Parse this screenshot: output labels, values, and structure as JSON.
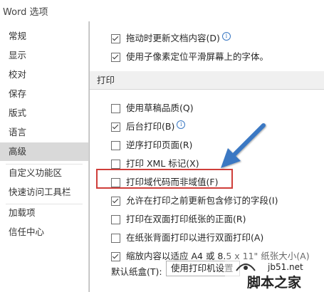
{
  "window": {
    "title": "Word 选项"
  },
  "sidebar": {
    "items": [
      {
        "label": "常规"
      },
      {
        "label": "显示"
      },
      {
        "label": "校对"
      },
      {
        "label": "保存"
      },
      {
        "label": "版式"
      },
      {
        "label": "语言"
      },
      {
        "label": "高级",
        "active": true
      },
      {
        "label": "自定义功能区"
      },
      {
        "label": "快速访问工具栏"
      },
      {
        "label": "加载项"
      },
      {
        "label": "信任中心"
      }
    ]
  },
  "options_top": [
    {
      "label": "拖动时更新文档内容(D)",
      "checked": true,
      "info_icon": true
    },
    {
      "label": "使用子像素定位平滑屏幕上的字体。",
      "checked": true
    }
  ],
  "print_section": {
    "header": "打印",
    "options": [
      {
        "label": "使用草稿品质(Q)",
        "checked": false
      },
      {
        "label": "后台打印(B)",
        "checked": true,
        "info_icon": true
      },
      {
        "label": "逆序打印页面(R)",
        "checked": false
      },
      {
        "label": "打印 XML 标记(X)",
        "checked": false
      },
      {
        "label": "打印域代码而非域值(F)",
        "checked": false,
        "highlighted": true
      },
      {
        "label": "允许在打印之前更新包含修订的字段(I)",
        "checked": true
      },
      {
        "label": "打印在双面打印纸张的正面(R)",
        "checked": false
      },
      {
        "label": "在纸张背面打印以进行双面打印(A)",
        "checked": false
      },
      {
        "label": "缩放内容以适应 A4 或 8.5 x 11\" 纸张大小(A)",
        "checked": true
      }
    ],
    "tray_label": "默认纸盒(T):",
    "tray_value": "使用打印机设置"
  },
  "annotation": {
    "highlight_color": "#cf3e3a",
    "arrow_color": "#3a78c3"
  },
  "watermark": {
    "url": "jb51.net",
    "text": "脚本之家"
  }
}
